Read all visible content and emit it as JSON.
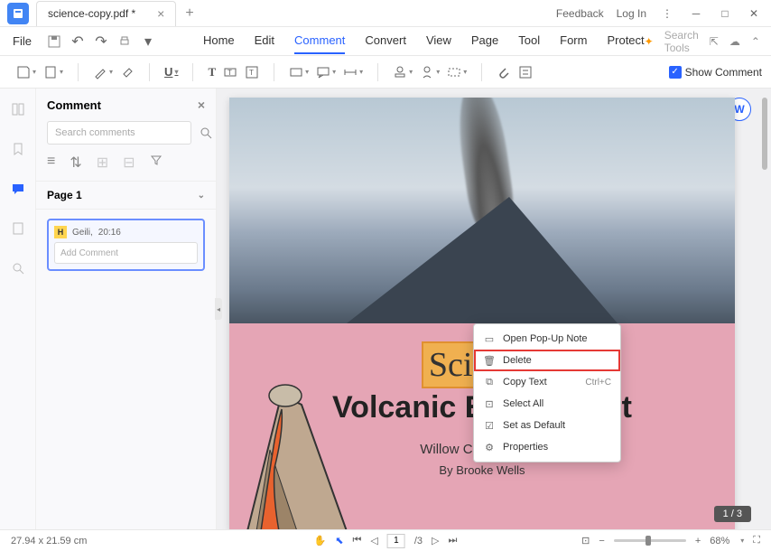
{
  "titlebar": {
    "filename": "science-copy.pdf *",
    "feedback": "Feedback",
    "login": "Log In"
  },
  "menubar": {
    "file": "File",
    "tabs": [
      "Home",
      "Edit",
      "Comment",
      "Convert",
      "View",
      "Page",
      "Tool",
      "Form",
      "Protect"
    ],
    "active_index": 2,
    "search_placeholder": "Search Tools"
  },
  "toolbar": {
    "show_comment": "Show Comment"
  },
  "panel": {
    "title": "Comment",
    "search_placeholder": "Search comments",
    "page_label": "Page 1",
    "comment": {
      "badge": "H",
      "author": "Geili,",
      "time": "20:16",
      "add_placeholder": "Add Comment"
    }
  },
  "document": {
    "highlighted_text": "Scienc",
    "title_rest": "e",
    "title_line2a": "Volcanic E",
    "title_line2b": "nt",
    "subtitle_a": "Willow Cree",
    "subtitle_b": "l",
    "byline": "By Brooke Wells",
    "page_counter": "1 / 3"
  },
  "context_menu": {
    "items": [
      {
        "label": "Open Pop-Up Note",
        "shortcut": ""
      },
      {
        "label": "Delete",
        "shortcut": "",
        "selected": true
      },
      {
        "label": "Copy Text",
        "shortcut": "Ctrl+C"
      },
      {
        "label": "Select All",
        "shortcut": ""
      },
      {
        "label": "Set as Default",
        "shortcut": ""
      },
      {
        "label": "Properties",
        "shortcut": ""
      }
    ]
  },
  "statusbar": {
    "dimensions": "27.94 x 21.59 cm",
    "page_current": "1",
    "page_total": "/3",
    "zoom": "68%"
  }
}
